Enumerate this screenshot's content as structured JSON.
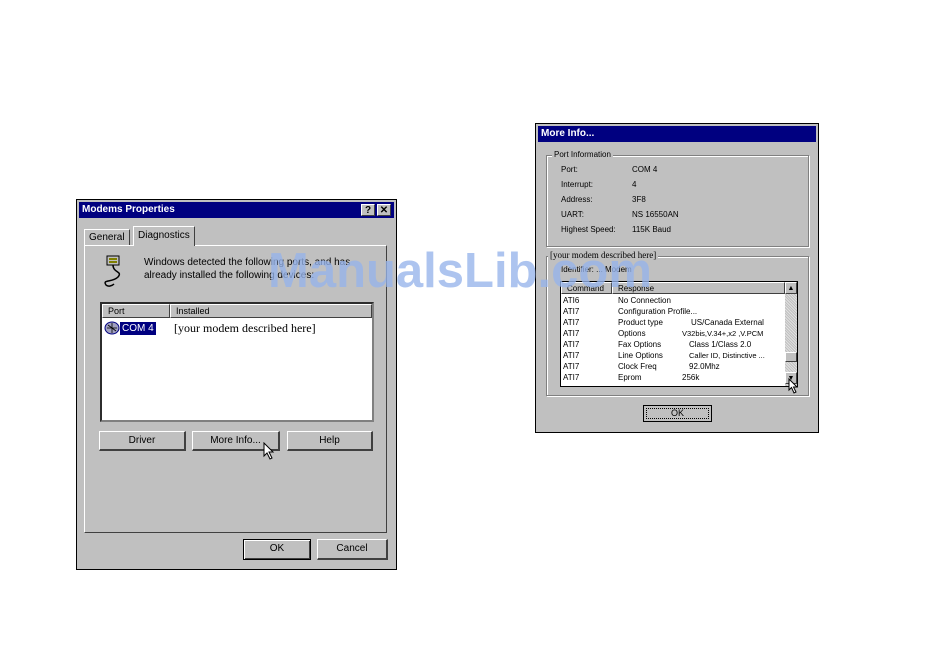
{
  "modems": {
    "title": "Modems Properties",
    "help_glyph": "?",
    "close_glyph": "✕",
    "tabs": [
      {
        "label": "General"
      },
      {
        "label": "Diagnostics"
      }
    ],
    "message_line1": "Windows detected the following ports, and has",
    "message_line2": "already installed the following devices:",
    "list_headers": {
      "port": "Port",
      "installed": "Installed"
    },
    "rows": [
      {
        "port": "COM 4",
        "installed": "[your modem described here]"
      }
    ],
    "buttons": {
      "driver": "Driver",
      "more_info": "More Info...",
      "help": "Help"
    },
    "ok": "OK",
    "cancel": "Cancel"
  },
  "more_info": {
    "title": "More Info...",
    "port_group_label": "Port Information",
    "port_info": [
      {
        "label": "Port:",
        "value": "COM 4"
      },
      {
        "label": "Interrupt:",
        "value": "4"
      },
      {
        "label": "Address:",
        "value": "3F8"
      },
      {
        "label": "UART:",
        "value": "NS 16550AN"
      },
      {
        "label": "Highest Speed:",
        "value": "115K Baud"
      }
    ],
    "modem_group_label": "[your modem described here]",
    "identifier_label": "Identifier:  ...  Modem",
    "table_headers": {
      "command": "Command",
      "response": "Response"
    },
    "rows": [
      {
        "command": "ATI6",
        "name": "No Connection",
        "value": ""
      },
      {
        "command": "ATI7",
        "name": "Configuration Profile...",
        "value": ""
      },
      {
        "command": "ATI7",
        "name": "Product type",
        "value": "US/Canada External"
      },
      {
        "command": "ATI7",
        "name": "Options",
        "value": "V32bis,V.34+,x2 ,V.PCM"
      },
      {
        "command": "ATI7",
        "name": "Fax Options",
        "value": "Class 1/Class 2.0"
      },
      {
        "command": "ATI7",
        "name": "Line Options",
        "value": "Caller ID, Distinctive ..."
      },
      {
        "command": "ATI7",
        "name": "Clock Freq",
        "value": "92.0Mhz"
      },
      {
        "command": "ATI7",
        "name": "Eprom",
        "value": "256k"
      }
    ],
    "ok": "OK"
  },
  "watermark": "ManualsLib.com",
  "icons": [
    "modem-cable-icon",
    "modem-device-icon",
    "mouse-cursor-icon",
    "scroll-up-icon",
    "scroll-down-icon"
  ]
}
